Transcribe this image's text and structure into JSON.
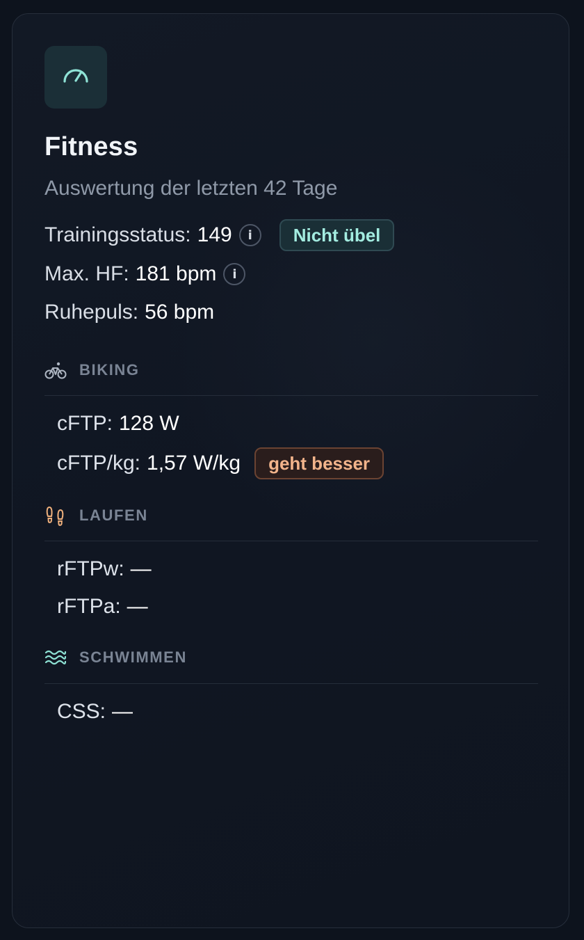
{
  "card": {
    "icon": "speedometer-icon",
    "title": "Fitness",
    "subtitle": "Auswertung der letzten 42 Tage"
  },
  "stats": {
    "training_status": {
      "label": "Trainingsstatus:",
      "value": "149",
      "info_icon": "i",
      "badge": "Nicht übel"
    },
    "max_hr": {
      "label": "Max. HF:",
      "value": "181 bpm",
      "info_icon": "i"
    },
    "resting_hr": {
      "label": "Ruhepuls:",
      "value": "56 bpm"
    }
  },
  "sections": {
    "biking": {
      "title": "BIKING",
      "icon": "bicycle-icon",
      "metrics": [
        {
          "label": "cFTP:",
          "value": "128 W"
        },
        {
          "label": "cFTP/kg:",
          "value": "1,57 W/kg",
          "badge": "geht besser"
        }
      ]
    },
    "running": {
      "title": "LAUFEN",
      "icon": "footprints-icon",
      "metrics": [
        {
          "label": "rFTPw:",
          "value": "—"
        },
        {
          "label": "rFTPa:",
          "value": "—"
        }
      ]
    },
    "swimming": {
      "title": "SCHWIMMEN",
      "icon": "waves-icon",
      "metrics": [
        {
          "label": "CSS:",
          "value": "—"
        }
      ]
    }
  },
  "colors": {
    "accent_teal": "#a3ece0",
    "accent_orange": "#f2b48b",
    "background": "#0d131d"
  }
}
